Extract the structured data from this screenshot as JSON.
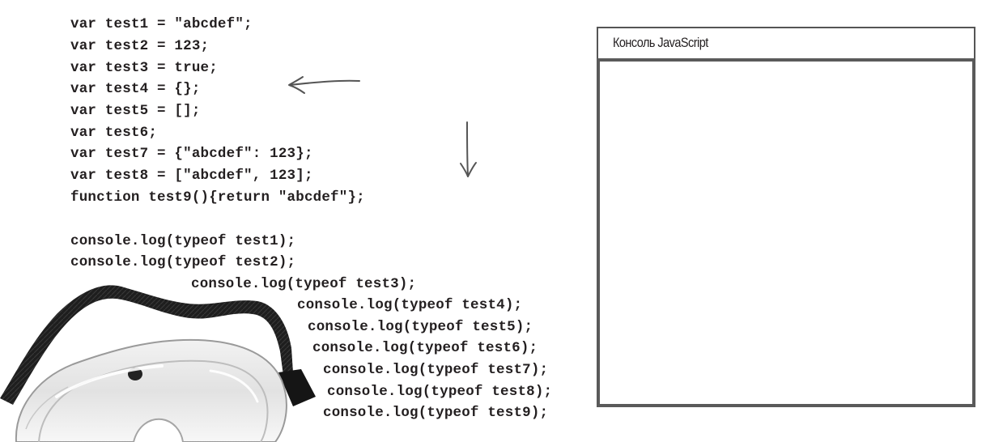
{
  "code": {
    "declarations": [
      "var test1 = \"abcdef\";",
      "var test2 = 123;",
      "var test3 = true;",
      "var test4 = {};",
      "var test5 = [];",
      "var test6;",
      "var test7 = {\"abcdef\": 123};",
      "var test8 = [\"abcdef\", 123];",
      "function test9(){return \"abcdef\"};"
    ],
    "logs": [
      "console.log(typeof test1);",
      "console.log(typeof test2);",
      "console.log(typeof test3);",
      "console.log(typeof test4);",
      "console.log(typeof test5);",
      "console.log(typeof test6);",
      "console.log(typeof test7);",
      "console.log(typeof test8);",
      "console.log(typeof test9);"
    ]
  },
  "console": {
    "title": "Консоль JavaScript",
    "output": ""
  },
  "illustrations": {
    "goggles": "safety-goggles-image",
    "arrow_left": "hand-drawn-arrow-left-icon",
    "arrow_down": "hand-drawn-arrow-down-icon"
  }
}
